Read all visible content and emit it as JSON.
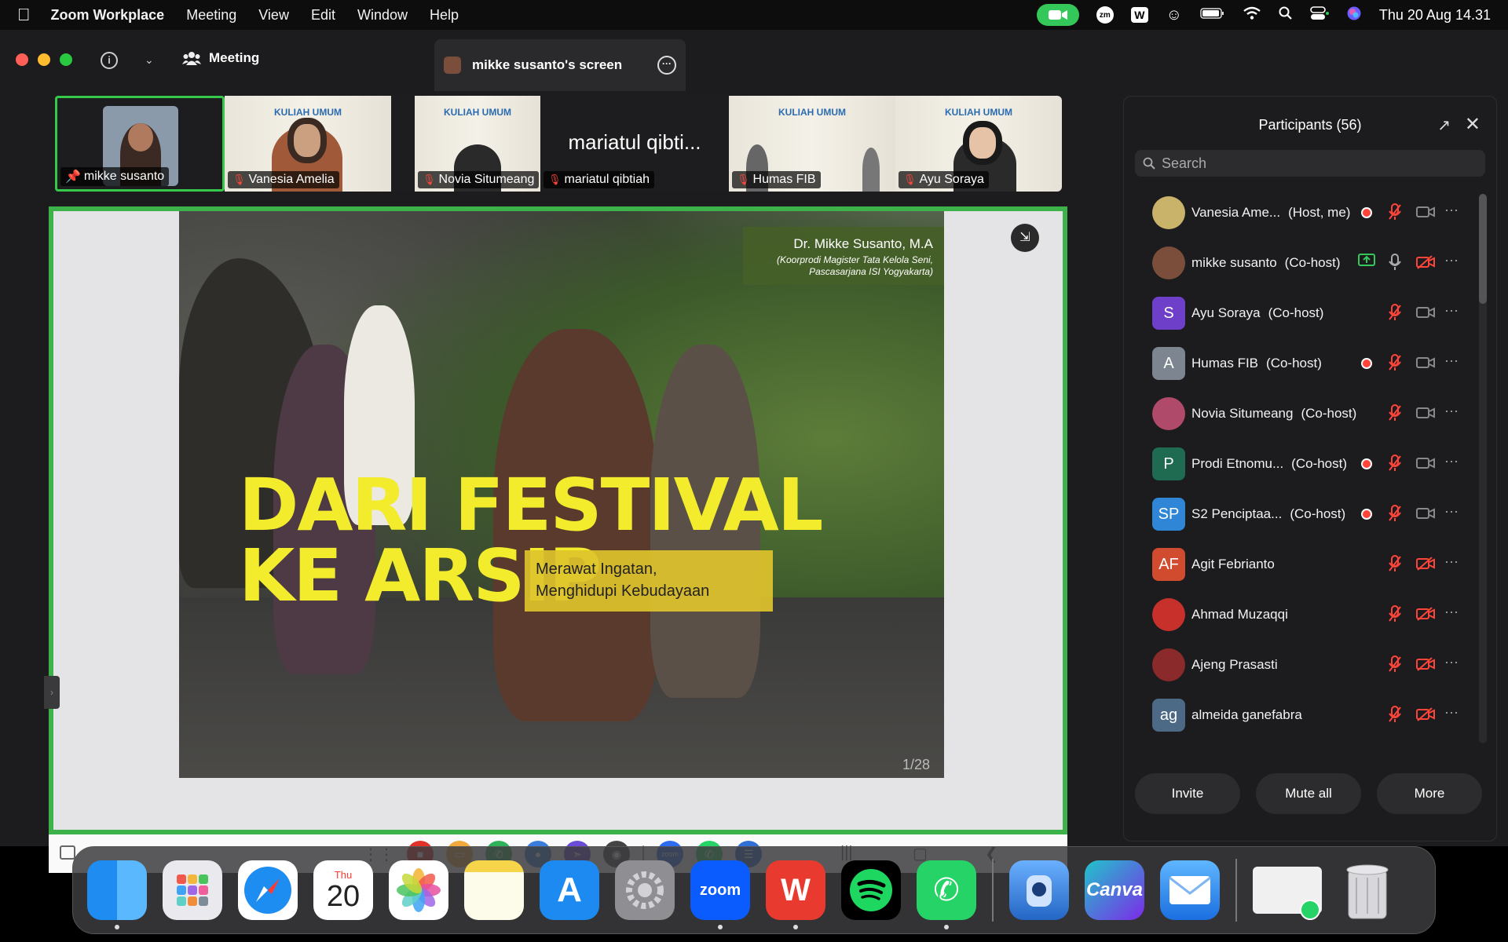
{
  "menubar": {
    "app_name": "Zoom Workplace",
    "items": [
      "Meeting",
      "View",
      "Edit",
      "Window",
      "Help"
    ],
    "clock": "Thu 20 Aug  14.31",
    "status_icons": [
      "zoom-camera-icon",
      "zm-icon",
      "wps-icon",
      "emoji-icon",
      "battery-icon",
      "wifi-icon",
      "search-icon",
      "control-center-icon",
      "siri-icon"
    ]
  },
  "titlebar": {
    "meeting_label": "Meeting",
    "tab_title": "mikke susanto's screen"
  },
  "thumbnails": [
    {
      "name": "mikke susanto",
      "pinned": true,
      "muted": false,
      "active": true
    },
    {
      "name": "Vanesia Amelia",
      "muted": true,
      "slide_text": "KULIAH UMUM"
    },
    {
      "name": "Novia Situmeang",
      "muted": true,
      "slide_text": "KULIAH UMUM"
    },
    {
      "name": "mariatul qibtiah",
      "muted": true,
      "big_label": "mariatul qibti..."
    },
    {
      "name": "Humas FIB",
      "muted": true,
      "slide_text": "KULIAH UMUM"
    },
    {
      "name": "Ayu Soraya",
      "muted": true,
      "slide_text": "KULIAH UMUM"
    }
  ],
  "slide": {
    "speaker_name": "Dr. Mikke Susanto, M.A",
    "speaker_role_1": "(Koorprodi Magister Tata Kelola Seni,",
    "speaker_role_2": "Pascasarjana ISI Yogyakarta)",
    "title_line_1": "DARI FESTIVAL",
    "title_line_2": "KE ARSIP",
    "subtitle_1": "Merawat Ingatan,",
    "subtitle_2": "Menghidupi Kebudayaan",
    "page": "1/28"
  },
  "participants": {
    "header": "Participants (56)",
    "search_placeholder": "Search",
    "rows": [
      {
        "name": "Vanesia Ame...",
        "role": "(Host, me)",
        "avatar": "",
        "color": "#c9b26a",
        "rec": true,
        "mic": "muted",
        "video": "on"
      },
      {
        "name": "mikke susanto",
        "role": "(Co-host)",
        "avatar": "",
        "color": "#7a4e3a",
        "share": true,
        "mic": "on",
        "video": "off"
      },
      {
        "name": "Ayu Soraya",
        "role": "(Co-host)",
        "avatar": "S",
        "color": "#6e3fc8",
        "mic": "muted",
        "video": "on"
      },
      {
        "name": "Humas FIB",
        "role": "(Co-host)",
        "avatar": "A",
        "color": "#7c8590",
        "rec": true,
        "mic": "muted",
        "video": "on"
      },
      {
        "name": "Novia Situmeang",
        "role": "(Co-host)",
        "avatar": "",
        "color": "#b04a6a",
        "mic": "muted",
        "video": "on"
      },
      {
        "name": "Prodi Etnomu...",
        "role": "(Co-host)",
        "avatar": "P",
        "color": "#1f6b52",
        "rec": true,
        "mic": "muted",
        "video": "on"
      },
      {
        "name": "S2 Penciptaa...",
        "role": "(Co-host)",
        "avatar": "SP",
        "color": "#2f86d6",
        "rec": true,
        "mic": "muted",
        "video": "on"
      },
      {
        "name": "Agit Febrianto",
        "role": "",
        "avatar": "AF",
        "color": "#d14b2e",
        "mic": "muted",
        "video": "off"
      },
      {
        "name": "Ahmad Muzaqqi",
        "role": "",
        "avatar": "",
        "color": "#c7302b",
        "mic": "muted",
        "video": "off"
      },
      {
        "name": "Ajeng Prasasti",
        "role": "",
        "avatar": "",
        "color": "#8a2a2a",
        "mic": "muted",
        "video": "off"
      },
      {
        "name": "almeida ganefabra",
        "role": "",
        "avatar": "ag",
        "color": "#4c6a86",
        "mic": "muted",
        "video": "off"
      }
    ],
    "buttons": [
      "Invite",
      "Mute all",
      "More"
    ]
  },
  "dock": {
    "apps": [
      "Finder",
      "Launchpad",
      "Safari",
      "Calendar",
      "Photos",
      "Notes",
      "App Store",
      "System Settings",
      "Zoom",
      "WPS",
      "Spotify",
      "WhatsApp",
      "Preview",
      "Canva",
      "Mail",
      "Screenshot",
      "Trash"
    ],
    "calendar_day": "Thu",
    "calendar_date": "20",
    "zoom_label": "zoom",
    "canva_label": "Canva"
  }
}
